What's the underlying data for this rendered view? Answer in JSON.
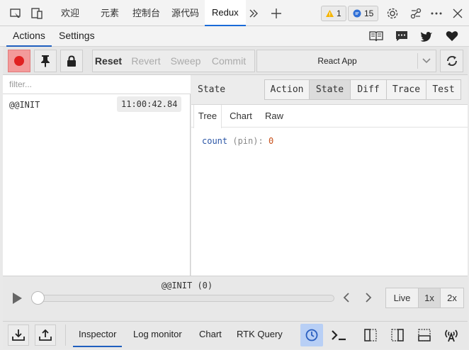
{
  "devtools": {
    "tabs": [
      "欢迎",
      "元素",
      "控制台",
      "源代码",
      "Redux"
    ],
    "active_tab": "Redux",
    "warnings_count": "1",
    "messages_count": "15"
  },
  "redux_header": {
    "tabs": [
      "Actions",
      "Settings"
    ]
  },
  "toolbar": {
    "reset": "Reset",
    "revert": "Revert",
    "sweep": "Sweep",
    "commit": "Commit",
    "instance": "React App"
  },
  "actions": {
    "filter_placeholder": "filter...",
    "list": [
      {
        "name": "@@INIT",
        "time": "11:00:42.84"
      }
    ]
  },
  "state_panel": {
    "title": "State",
    "tabs": [
      "Action",
      "State",
      "Diff",
      "Trace",
      "Test"
    ],
    "active_tab": "State",
    "subtabs": [
      "Tree",
      "Chart",
      "Raw"
    ],
    "active_subtab": "Tree",
    "tree": {
      "key": "count",
      "meta": "(pin)",
      "value": "0"
    }
  },
  "slider": {
    "label": "@@INIT (0)",
    "position_fraction": 0,
    "modes": [
      "Live",
      "1x",
      "2x"
    ],
    "active_mode": "1x"
  },
  "bottom": {
    "tabs": [
      "Inspector",
      "Log monitor",
      "Chart",
      "RTK Query"
    ],
    "active_tab": "Inspector"
  },
  "colors": {
    "accent": "#1f5fbf",
    "record_red": "#e02020",
    "record_bg": "#f39a9a",
    "warning": "#f5b400",
    "message": "#2f6fd6",
    "tree_key": "#2a55a6",
    "tree_value": "#c8501a"
  }
}
